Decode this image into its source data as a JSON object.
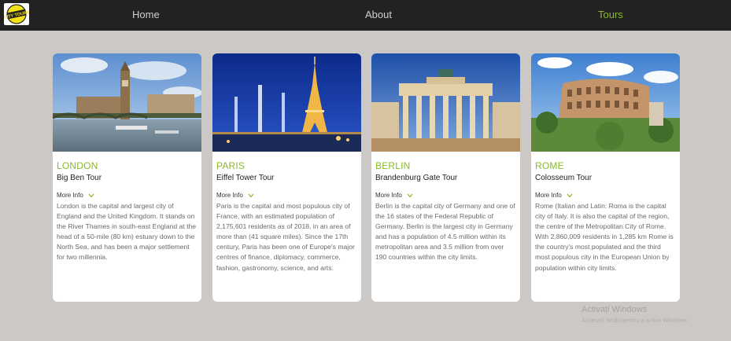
{
  "nav": {
    "logo_text": "CITY TOURS",
    "links": [
      {
        "label": "Home",
        "active": false
      },
      {
        "label": "About",
        "active": false
      },
      {
        "label": "Tours",
        "active": true
      }
    ]
  },
  "colors": {
    "accent": "#89b92c",
    "navbar": "#222222",
    "background": "#cbc8c6"
  },
  "cards": [
    {
      "city": "LONDON",
      "tour": "Big Ben Tour",
      "more": "More Info",
      "image": "big-ben-photo",
      "description": "London is the capital and largest city of England and the United Kingdom. It stands on the River Thames in south-east England at the head of a 50-mile (80 km) estuary down to the North Sea, and has been a major settlement for two millennia."
    },
    {
      "city": "PARIS",
      "tour": "Eiffel Tower Tour",
      "more": "More Info",
      "image": "eiffel-tower-photo",
      "description": "Paris is the capital and most populous city of France, with an estimated population of 2,175,601 residents as of 2018, in an area of more than (41 square miles). Since the 17th century, Paris has been one of Europe's major centres of finance, diplomacy, commerce, fashion, gastronomy, science, and arts."
    },
    {
      "city": "BERLIN",
      "tour": "Brandenburg Gate Tour",
      "more": "More Info",
      "image": "brandenburg-gate-photo",
      "description": "Berlin is the capital city of Germany and one of the 16 states of the Federal Republic of Germany. Berlin is the largest city in Germany and has a population of 4.5 million within its metropolitan area and 3.5 million from over 190 countries within the city limits."
    },
    {
      "city": "ROME",
      "tour": "Colosseum Tour",
      "more": "More Info",
      "image": "colosseum-photo",
      "description": "Rome (Italian and Latin: Roma is the capital city of Italy. It is also the capital of the region, the centre of the Metropolitan City of Rome. With 2,860,009 residents in 1,285 km Rome is the country's most populated and the third most populous city in the European Union by population within city limits."
    }
  ],
  "watermark": {
    "title": "Activați Windows",
    "subtitle": "Accesați Setări pentru a activa Windows."
  }
}
